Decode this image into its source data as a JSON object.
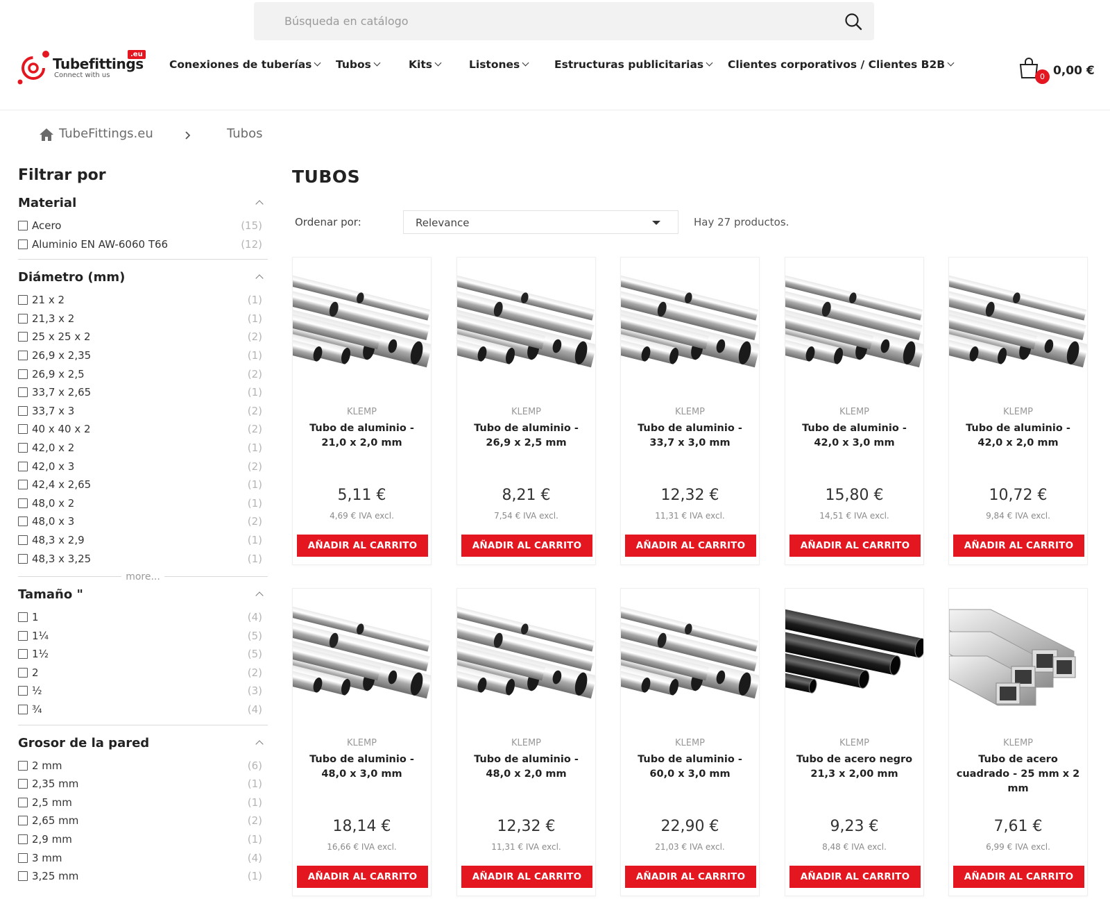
{
  "search": {
    "placeholder": "Búsqueda en catálogo"
  },
  "logo": {
    "name": "Tubefittings",
    "tagline": "Connect with us",
    "badge": ".eu"
  },
  "nav": [
    "Conexiones de tuberías",
    "Tubos",
    "Kits",
    "Listones",
    "Estructuras publicitarias",
    "Clientes corporativos / Clientes B2B"
  ],
  "cart": {
    "count": "0",
    "total": "0,00 €"
  },
  "breadcrumb": {
    "home": "TubeFittings.eu",
    "current": "Tubos"
  },
  "filters": {
    "title": "Filtrar por",
    "more": "more...",
    "groups": [
      {
        "title": "Material",
        "options": [
          {
            "label": "Acero",
            "count": "(15)"
          },
          {
            "label": "Aluminio EN AW-6060 T66",
            "count": "(12)"
          }
        ]
      },
      {
        "title": "Diámetro (mm)",
        "options": [
          {
            "label": "21 x 2",
            "count": "(1)"
          },
          {
            "label": "21,3 x 2",
            "count": "(1)"
          },
          {
            "label": "25 x 25 x 2",
            "count": "(2)"
          },
          {
            "label": "26,9 x 2,35",
            "count": "(1)"
          },
          {
            "label": "26,9 x 2,5",
            "count": "(2)"
          },
          {
            "label": "33,7 x 2,65",
            "count": "(1)"
          },
          {
            "label": "33,7 x 3",
            "count": "(2)"
          },
          {
            "label": "40 x 40 x 2",
            "count": "(2)"
          },
          {
            "label": "42,0 x 2",
            "count": "(1)"
          },
          {
            "label": "42,0 x 3",
            "count": "(2)"
          },
          {
            "label": "42,4 x 2,65",
            "count": "(1)"
          },
          {
            "label": "48,0 x 2",
            "count": "(1)"
          },
          {
            "label": "48,0 x 3",
            "count": "(2)"
          },
          {
            "label": "48,3 x 2,9",
            "count": "(1)"
          },
          {
            "label": "48,3 x 3,25",
            "count": "(1)"
          }
        ]
      },
      {
        "title": "Tamaño \"",
        "options": [
          {
            "label": "1",
            "count": "(4)"
          },
          {
            "label": "1¼",
            "count": "(5)"
          },
          {
            "label": "1½",
            "count": "(5)"
          },
          {
            "label": "2",
            "count": "(2)"
          },
          {
            "label": "½",
            "count": "(3)"
          },
          {
            "label": "¾",
            "count": "(4)"
          }
        ]
      },
      {
        "title": "Grosor de la pared",
        "options": [
          {
            "label": "2 mm",
            "count": "(6)"
          },
          {
            "label": "2,35 mm",
            "count": "(1)"
          },
          {
            "label": "2,5 mm",
            "count": "(1)"
          },
          {
            "label": "2,65 mm",
            "count": "(2)"
          },
          {
            "label": "2,9 mm",
            "count": "(1)"
          },
          {
            "label": "3 mm",
            "count": "(4)"
          },
          {
            "label": "3,25 mm",
            "count": "(1)"
          }
        ]
      }
    ]
  },
  "main": {
    "title": "TUBOS",
    "sort_label": "Ordenar por:",
    "sort_value": "Relevance",
    "product_count": "Hay 27 productos."
  },
  "add_to_cart": "AÑADIR AL CARRITO",
  "products": [
    {
      "brand": "KLEMP",
      "name": "Tubo de aluminio - 21,0 x 2,0 mm",
      "price": "5,11 €",
      "excl": "4,69 € IVA excl.",
      "image": "aluminum-tubes"
    },
    {
      "brand": "KLEMP",
      "name": "Tubo de aluminio - 26,9 x 2,5 mm",
      "price": "8,21 €",
      "excl": "7,54 € IVA excl.",
      "image": "aluminum-tubes"
    },
    {
      "brand": "KLEMP",
      "name": "Tubo de aluminio - 33,7 x 3,0 mm",
      "price": "12,32 €",
      "excl": "11,31 € IVA excl.",
      "image": "aluminum-tubes"
    },
    {
      "brand": "KLEMP",
      "name": "Tubo de aluminio - 42,0 x 3,0 mm",
      "price": "15,80 €",
      "excl": "14,51 € IVA excl.",
      "image": "aluminum-tubes"
    },
    {
      "brand": "KLEMP",
      "name": "Tubo de aluminio - 42,0 x 2,0 mm",
      "price": "10,72 €",
      "excl": "9,84 € IVA excl.",
      "image": "aluminum-tubes"
    },
    {
      "brand": "KLEMP",
      "name": "Tubo de aluminio - 48,0 x 3,0 mm",
      "price": "18,14 €",
      "excl": "16,66 € IVA excl.",
      "image": "aluminum-tubes"
    },
    {
      "brand": "KLEMP",
      "name": "Tubo de aluminio - 48,0 x 2,0 mm",
      "price": "12,32 €",
      "excl": "11,31 € IVA excl.",
      "image": "aluminum-tubes"
    },
    {
      "brand": "KLEMP",
      "name": "Tubo de aluminio - 60,0 x 3,0 mm",
      "price": "22,90 €",
      "excl": "21,03 € IVA excl.",
      "image": "aluminum-tubes"
    },
    {
      "brand": "KLEMP",
      "name": "Tubo de acero negro 21,3 x 2,00 mm",
      "price": "9,23 €",
      "excl": "8,48 € IVA excl.",
      "image": "black-steel-tubes"
    },
    {
      "brand": "KLEMP",
      "name": "Tubo de acero cuadrado - 25 mm x 2 mm",
      "price": "7,61 €",
      "excl": "6,99 € IVA excl.",
      "image": "square-steel-tubes"
    }
  ],
  "colors": {
    "accent": "#e4161f",
    "text": "#232323",
    "muted": "#8a8a8a"
  }
}
